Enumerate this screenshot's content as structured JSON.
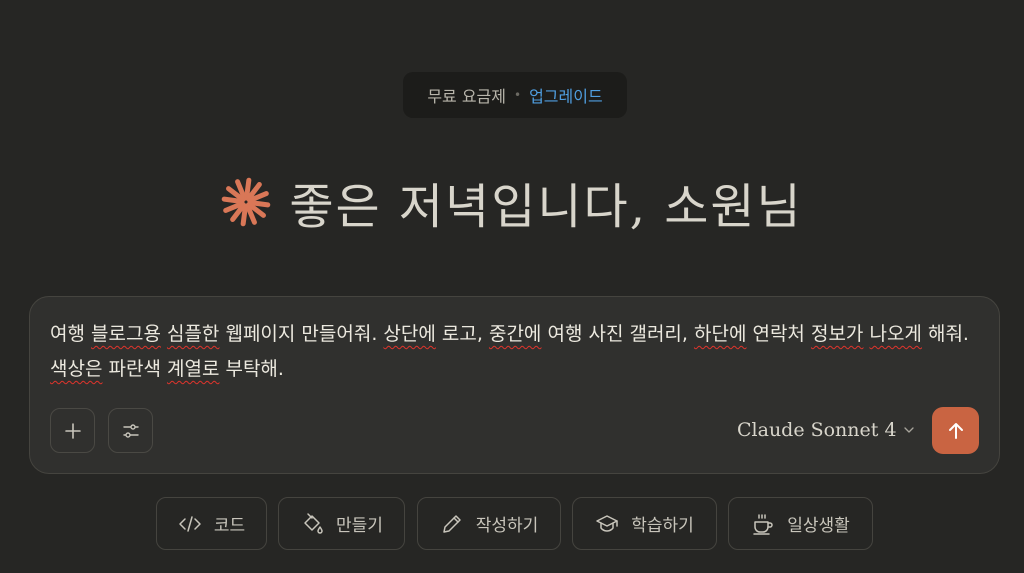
{
  "plan": {
    "name": "무료 요금제",
    "separator": "•",
    "upgrade": "업그레이드"
  },
  "greeting": {
    "text": "좋은 저녁입니다, 소원님",
    "icon": "claude-spark-icon",
    "icon_color": "#d97757"
  },
  "composer": {
    "segments": [
      {
        "text": "여행 ",
        "spell": false
      },
      {
        "text": "블로그용",
        "spell": true
      },
      {
        "text": " ",
        "spell": false
      },
      {
        "text": "심플한",
        "spell": true
      },
      {
        "text": " 웹페이지 만들어줘. ",
        "spell": false
      },
      {
        "text": "상단에",
        "spell": true
      },
      {
        "text": " 로고, ",
        "spell": false
      },
      {
        "text": "중간에",
        "spell": true
      },
      {
        "text": " 여행 사진 갤러리, ",
        "spell": false
      },
      {
        "text": "하단에",
        "spell": true
      },
      {
        "text": " 연락처 ",
        "spell": false
      },
      {
        "text": "정보가",
        "spell": true
      },
      {
        "text": " ",
        "spell": false
      },
      {
        "text": "나오게",
        "spell": true
      },
      {
        "text": " 해줘. ",
        "spell": false
      },
      {
        "text": "색상은",
        "spell": true
      },
      {
        "text": " 파란색 ",
        "spell": false
      },
      {
        "text": "계열로",
        "spell": true
      },
      {
        "text": " 부탁해.",
        "spell": false
      }
    ],
    "add_button_icon": "plus-icon",
    "tools_button_icon": "sliders-icon",
    "model": {
      "brand": "Claude",
      "name": "Sonnet 4",
      "icon": "chevron-down-icon"
    },
    "send_icon": "arrow-up-icon",
    "send_color": "#c96442"
  },
  "chips": [
    {
      "label": "코드",
      "icon": "code-icon"
    },
    {
      "label": "만들기",
      "icon": "paint-bucket-icon"
    },
    {
      "label": "작성하기",
      "icon": "pencil-icon"
    },
    {
      "label": "학습하기",
      "icon": "graduation-cap-icon"
    },
    {
      "label": "일상생활",
      "icon": "coffee-cup-icon"
    }
  ],
  "colors": {
    "background": "#262624",
    "composer": "#30302e",
    "accent": "#c96442",
    "link": "#4f9ee0"
  }
}
